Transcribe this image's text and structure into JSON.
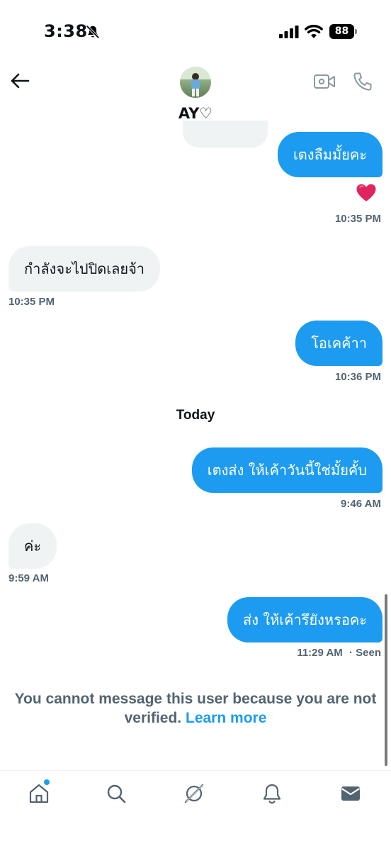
{
  "status_bar": {
    "time": "3:38",
    "battery": "88",
    "icons": [
      "bell-off-icon",
      "signal-icon",
      "wifi-icon",
      "battery-icon"
    ]
  },
  "header": {
    "contact_name": "AY♡",
    "icons": [
      "back-arrow-icon",
      "video-call-icon",
      "phone-icon"
    ]
  },
  "messages": [
    {
      "direction": "out",
      "text": "เตงลืมมั้ยคะ",
      "reaction": "❤️",
      "time": "10:35 PM"
    },
    {
      "direction": "in",
      "text": "กำลังจะไปปิดเลยจ้า",
      "time": "10:35 PM"
    },
    {
      "direction": "out",
      "text": "โอเคค้าา",
      "time": "10:36 PM"
    },
    {
      "direction": "out",
      "text": "เตงส่ง ให้เค้าวันนี้ใช่มั้ยคั้บ",
      "time": "9:46 AM"
    },
    {
      "direction": "in",
      "text": "ค่ะ",
      "time": "9:59 AM"
    },
    {
      "direction": "out",
      "text": "ส่ง ให้เค้ารึยังหรอคะ",
      "time": "11:29 AM",
      "status": "· Seen"
    }
  ],
  "day_separator": "Today",
  "notice": {
    "text": "You cannot message this user because you are not verified.",
    "link": "Learn more"
  },
  "colors": {
    "accent": "#1d9bf0",
    "incoming_bubble": "#eff3f4",
    "muted_text": "#536471",
    "heart": "#e0245e"
  },
  "tabbar": {
    "items": [
      "home-icon",
      "search-icon",
      "grok-icon",
      "notifications-icon",
      "messages-icon"
    ],
    "active": "messages-icon",
    "home_has_badge": true
  }
}
